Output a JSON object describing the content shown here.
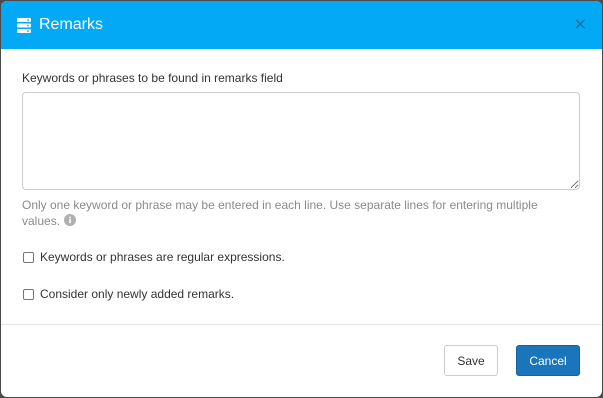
{
  "header": {
    "title": "Remarks",
    "icon": "server-stack-icon",
    "close_glyph": "×",
    "background_color": "#03a9f4"
  },
  "body": {
    "keywords_label": "Keywords or phrases to be found in remarks field",
    "keywords_value": "",
    "help_text": "Only one keyword or phrase may be entered in each line. Use separate lines for entering multiple values.",
    "help_icon": "info-icon",
    "options": [
      {
        "label": "Keywords or phrases are regular expressions.",
        "checked": false
      },
      {
        "label": "Consider only newly added remarks.",
        "checked": false
      }
    ]
  },
  "footer": {
    "save_label": "Save",
    "cancel_label": "Cancel",
    "primary_color": "#1a75bb"
  }
}
